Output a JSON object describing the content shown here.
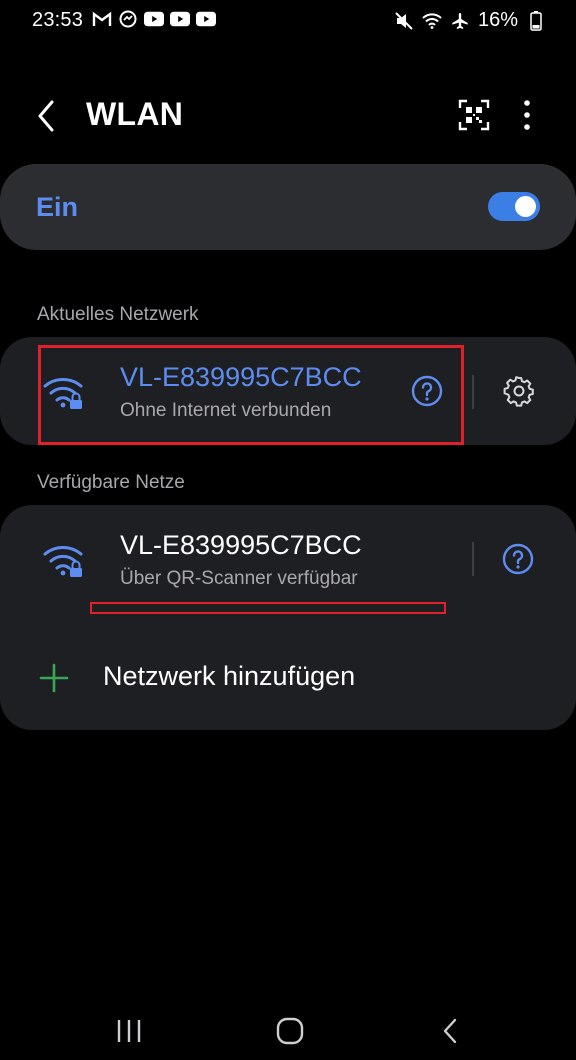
{
  "status_bar": {
    "time": "23:53",
    "left_icons": [
      "gmail-icon",
      "messenger-icon",
      "youtube-icon",
      "youtube-icon",
      "youtube-icon"
    ],
    "right_icons": [
      "mute-icon",
      "wifi-icon",
      "airplane-icon"
    ],
    "battery": "16%"
  },
  "header": {
    "title": "WLAN"
  },
  "wlan_toggle": {
    "label": "Ein",
    "state": "on"
  },
  "current_network": {
    "section_label": "Aktuelles Netzwerk",
    "name": "VL-E839995C7BCC",
    "status": "Ohne Internet verbunden"
  },
  "available_networks": {
    "section_label": "Verfügbare Netze",
    "items": [
      {
        "name": "VL-E839995C7BCC",
        "status": "Über QR-Scanner verfügbar"
      }
    ],
    "add_label": "Netzwerk hinzufügen"
  },
  "colors": {
    "accent": "#5d8df0",
    "toggle": "#3b7ee6",
    "card": "#1e1f22",
    "annotation": "#e0202a",
    "plus": "#3aa757"
  }
}
